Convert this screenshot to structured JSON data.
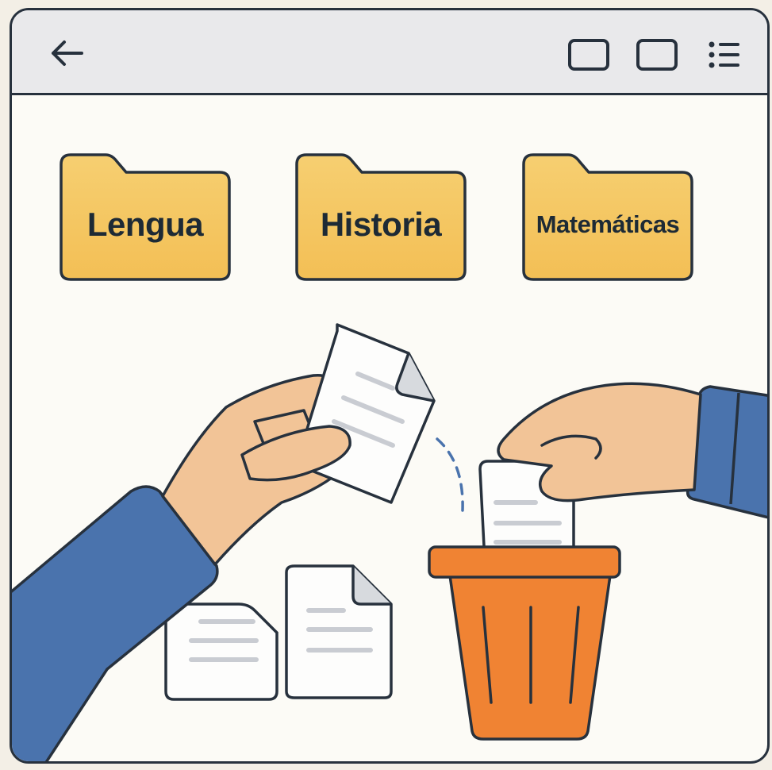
{
  "toolbar": {
    "back_icon": "arrow-left-icon",
    "window_icon_1": "window-square-icon",
    "window_icon_2": "window-square-icon",
    "menu_icon": "list-menu-icon"
  },
  "folders": [
    {
      "label": "Lengua",
      "icon": "folder-icon"
    },
    {
      "label": "Historia",
      "icon": "folder-icon"
    },
    {
      "label": "Matemáticas",
      "icon": "folder-icon"
    }
  ],
  "colors": {
    "folder_fill": "#f6c65f",
    "trash_fill": "#f08333",
    "sleeve": "#4a73ad",
    "skin": "#f2c497",
    "outline": "#27313d"
  }
}
